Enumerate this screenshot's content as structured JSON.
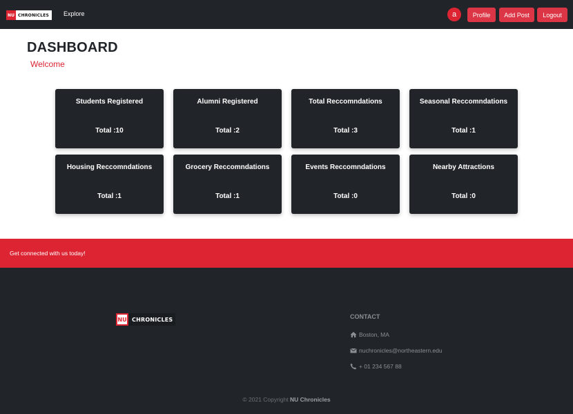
{
  "navbar": {
    "brand_badge": "NU",
    "brand_name": "CHRONICLES",
    "explore_label": "Explore",
    "avatar_letter": "a",
    "profile_label": "Profile",
    "add_post_label": "Add Post",
    "logout_label": "Logout"
  },
  "header": {
    "title": "DASHBOARD",
    "welcome": "Welcome"
  },
  "cards": [
    {
      "title": "Students Registered",
      "total": "Total :10"
    },
    {
      "title": "Alumni Registered",
      "total": "Total :2"
    },
    {
      "title": "Total Reccomndations",
      "total": "Total :3"
    },
    {
      "title": "Seasonal Reccomndations",
      "total": "Total :1"
    },
    {
      "title": "Housing Reccomndations",
      "total": "Total :1"
    },
    {
      "title": "Grocery Reccomndations",
      "total": "Total :1"
    },
    {
      "title": "Events Reccomndations",
      "total": "Total :0"
    },
    {
      "title": "Nearby Attractions",
      "total": "Total :0"
    }
  ],
  "cta": {
    "text": "Get connected with us today!"
  },
  "footer": {
    "brand_badge": "NU",
    "brand_name": "CHRONICLES",
    "contact_heading": "CONTACT",
    "address": "Boston, MA",
    "email": "nuchronicles@northeastern.edu",
    "phone": "+ 01 234 567 88",
    "copyright_prefix": "© 2021 Copyright ",
    "copyright_name": "NU Chronicles"
  },
  "colors": {
    "accent": "#dc2433",
    "dark": "#212529",
    "muted_text": "#8a8f94"
  },
  "icons": [
    "home-icon",
    "envelope-icon",
    "phone-icon"
  ]
}
